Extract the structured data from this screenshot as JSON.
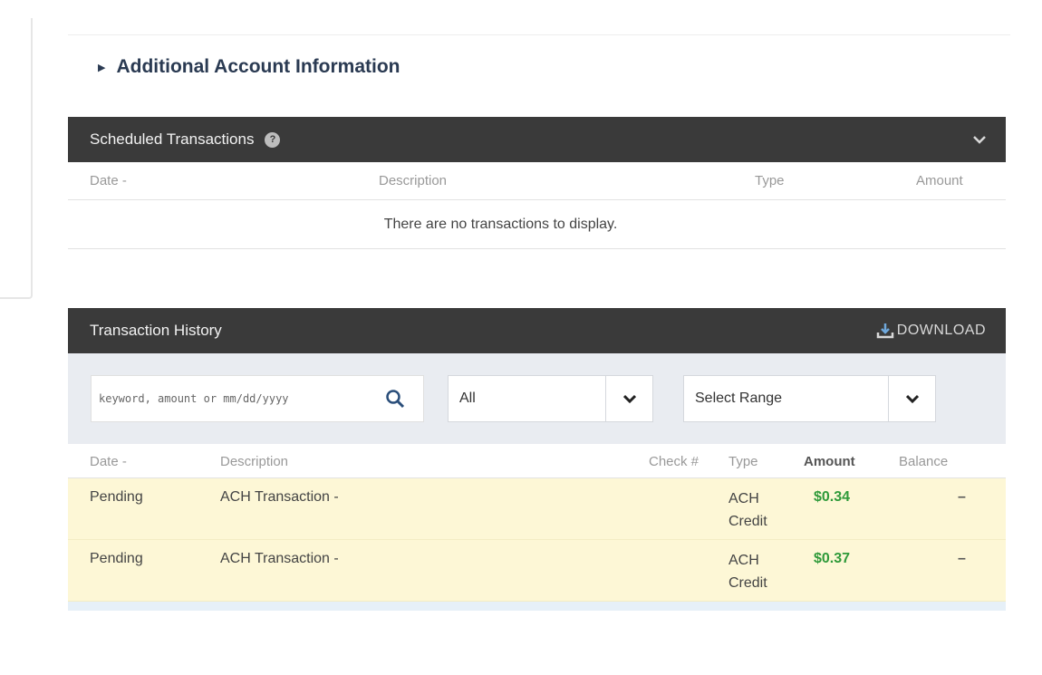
{
  "additional_info": {
    "label": "Additional Account Information"
  },
  "scheduled": {
    "title": "Scheduled Transactions",
    "help": "?",
    "columns": {
      "date": "Date -",
      "description": "Description",
      "type": "Type",
      "amount": "Amount"
    },
    "empty_message": "There are no transactions to display."
  },
  "history": {
    "title": "Transaction History",
    "download_label": "DOWNLOAD",
    "search": {
      "placeholder": "keyword, amount or mm/dd/yyyy"
    },
    "filter_type": {
      "selected": "All"
    },
    "filter_range": {
      "selected": "Select Range"
    },
    "columns": {
      "date": "Date -",
      "description": "Description",
      "check": "Check #",
      "type": "Type",
      "amount": "Amount",
      "balance": "Balance"
    },
    "rows": [
      {
        "date": "Pending",
        "description": "ACH Transaction -",
        "type_line1": "ACH",
        "type_line2": "Credit",
        "amount": "$0.34",
        "balance": "–"
      },
      {
        "date": "Pending",
        "description": "ACH Transaction -",
        "type_line1": "ACH",
        "type_line2": "Credit",
        "amount": "$0.37",
        "balance": "–"
      }
    ]
  },
  "colors": {
    "header_bg": "#3a3a3a",
    "pending_row_bg": "#fdf7d6",
    "amount_green": "#2f9a3a",
    "filter_bar_bg": "#e9ecf1"
  }
}
